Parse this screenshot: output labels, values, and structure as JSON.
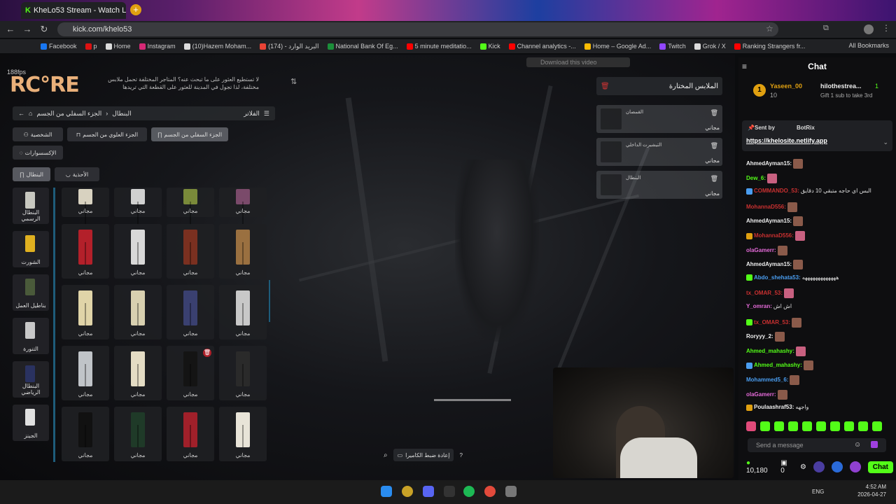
{
  "browser": {
    "tab_title": "KheLo53 Stream - Watch Li",
    "url": "kick.com/khelo53",
    "bookmarks": [
      {
        "label": "Facebook",
        "color": "#1877f2"
      },
      {
        "label": "p",
        "color": "#d11"
      },
      {
        "label": "Home",
        "color": "#ddd"
      },
      {
        "label": "Instagram",
        "color": "#d62976"
      },
      {
        "label": "(10)Hazem Moham...",
        "color": "#ddd"
      },
      {
        "label": "(174) - البريد الوارد",
        "color": "#ea4335"
      },
      {
        "label": "National Bank Of Eg...",
        "color": "#1b8f3a"
      },
      {
        "label": "5 minute meditatio...",
        "color": "#f00"
      },
      {
        "label": "Kick",
        "color": "#53fc18"
      },
      {
        "label": "Channel analytics -...",
        "color": "#f00"
      },
      {
        "label": "Home – Google Ad...",
        "color": "#fbbc04"
      },
      {
        "label": "Twitch",
        "color": "#9146ff"
      },
      {
        "label": "Grok / X",
        "color": "#ddd"
      },
      {
        "label": "Ranking Strangers fr...",
        "color": "#f00"
      }
    ],
    "all_bookmarks": "All Bookmarks"
  },
  "game": {
    "fps": "188fps",
    "logo": "RC°RE",
    "hint": "لا تستطيع العثور على ما تبحث عنه؟ المتاجر المختلفة تحمل ملابس مختلفة، لذا تجول في المدينة للعثور على القطعة التي تريدها",
    "breadcrumb_home": "الجزء السفلي من الجسم",
    "breadcrumb_current": "البنطال",
    "filters": "الفلاتر",
    "categories": [
      "الشخصية",
      "الجزء العلوي من الجسم",
      "الجزء السفلي من الجسم",
      "الإكسسوارات"
    ],
    "subcategories": [
      "البنطال",
      "الأحذية"
    ],
    "side_items": [
      "البنطال الرسمي",
      "الشورت",
      "بناطيل العمل",
      "التنورة",
      "البنطال الرياضي",
      "الجينز"
    ],
    "price": "مجاني",
    "selected_title": "الملابس المختارة",
    "selected": [
      {
        "name": "القمصان",
        "price": "مجاني"
      },
      {
        "name": "التيشيرت الداخلي",
        "price": "مجاني"
      },
      {
        "name": "البنطال",
        "price": "مجاني"
      }
    ],
    "download_video": "Download this video",
    "reset_camera": "إعادة ضبط الكاميرا",
    "item_colors": [
      "#d8d2c0",
      "#d0d0d0",
      "#7a8a3a",
      "#7a4a6a",
      "#b3202a",
      "#d8d8d8",
      "#7a3020",
      "#9a7040",
      "#e0d4a8",
      "#d8d0b0",
      "#3a4070",
      "#c8c8c8",
      "#c0c4c8",
      "#e4dcc4",
      "#141414",
      "#2a2a2a",
      "#111111",
      "#1f3a28",
      "#a0202a",
      "#e8e4d8"
    ]
  },
  "chat": {
    "title": "Chat",
    "pinned_user": "Yaseen_00",
    "pinned_count": "10",
    "pinned_gifter": "hilothestrea...",
    "pinned_gift_count": "1",
    "pinned_gift_text": "Gift 1 sub to take 3rd",
    "sent_by": "Sent by",
    "bot_name": "BotRix",
    "bot_link": "https://khelosite.netlify.app",
    "messages": [
      {
        "user": "AhmedAyman15:",
        "text": "",
        "color": "#eee"
      },
      {
        "user": "Dew_6:",
        "text": "",
        "color": "#53fc18"
      },
      {
        "user": "COMMANDO_53:",
        "text": "البس اي حاجه متبقي 10 دقايق",
        "color": "#c83030"
      },
      {
        "user": "MohannaD556:",
        "text": "",
        "color": "#c83030"
      },
      {
        "user": "AhmedAyman15:",
        "text": "",
        "color": "#eee"
      },
      {
        "user": "MohannaD556:",
        "text": "",
        "color": "#c83030"
      },
      {
        "user": "olaGamerr:",
        "text": "",
        "color": "#e46ad8"
      },
      {
        "user": "AhmedAyman15:",
        "text": "",
        "color": "#eee"
      },
      {
        "user": "Abdo_shehata53:",
        "text": "هههههههههههههه",
        "color": "#4a9df0"
      },
      {
        "user": "tx_OMAR_53:",
        "text": "",
        "color": "#c83030"
      },
      {
        "user": "Y_omran:",
        "text": "اش اش",
        "color": "#e46ad8"
      },
      {
        "user": "tx_OMAR_53:",
        "text": "",
        "color": "#c83030"
      },
      {
        "user": "Roryyy_2:",
        "text": "",
        "color": "#eee"
      },
      {
        "user": "Ahmed_mahashy:",
        "text": "",
        "color": "#53fc18"
      },
      {
        "user": "Ahmed_mahashy:",
        "text": "",
        "color": "#53fc18"
      },
      {
        "user": "Mohammed5_6:",
        "text": "",
        "color": "#4a9df0"
      },
      {
        "user": "olaGamerr:",
        "text": "",
        "color": "#e46ad8"
      },
      {
        "user": "Poulaashraf53:",
        "text": "واجهه",
        "color": "#eee"
      }
    ],
    "input_placeholder": "Send a message",
    "points": "10,180",
    "zero": "0",
    "send": "Chat"
  },
  "taskbar": {
    "lang": "ENG",
    "time": "4:52 AM",
    "date": "2026-04-27"
  }
}
